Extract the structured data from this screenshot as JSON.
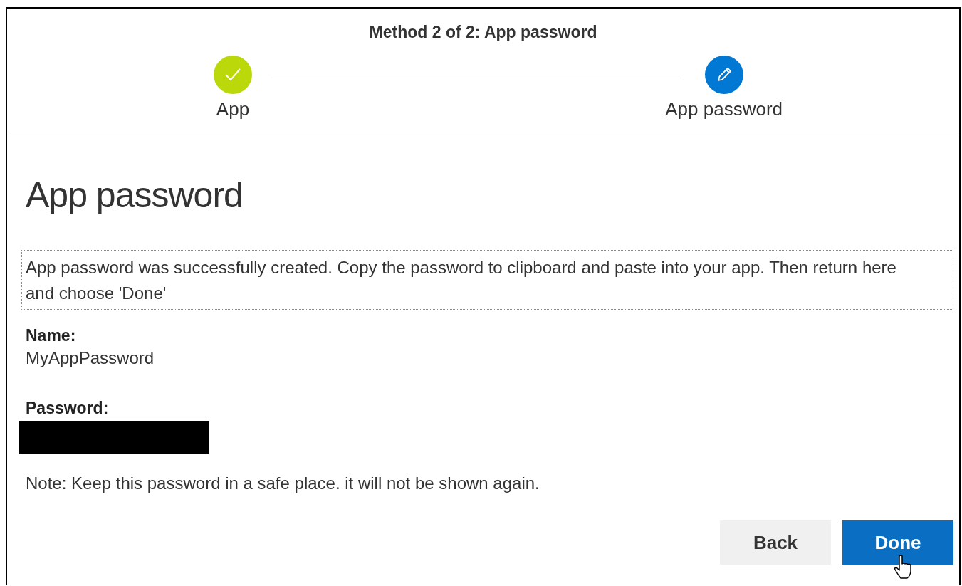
{
  "wizard": {
    "title": "Method 2 of 2: App password",
    "steps": [
      {
        "label": "App",
        "completed": true
      },
      {
        "label": "App password",
        "completed": false
      }
    ]
  },
  "content": {
    "heading": "App password",
    "message": "App password was successfully created. Copy the password to clipboard and paste into your app. Then return here and choose 'Done'",
    "fields": [
      {
        "label": "Name:",
        "value": "MyAppPassword",
        "redacted": false
      },
      {
        "label": "Password:",
        "redacted": true
      }
    ],
    "note": "Note: Keep this password in a safe place. it will not be shown again."
  },
  "buttons": [
    {
      "label": "Back",
      "kind": "secondary"
    },
    {
      "label": "Done",
      "kind": "primary",
      "hovered": true
    }
  ]
}
